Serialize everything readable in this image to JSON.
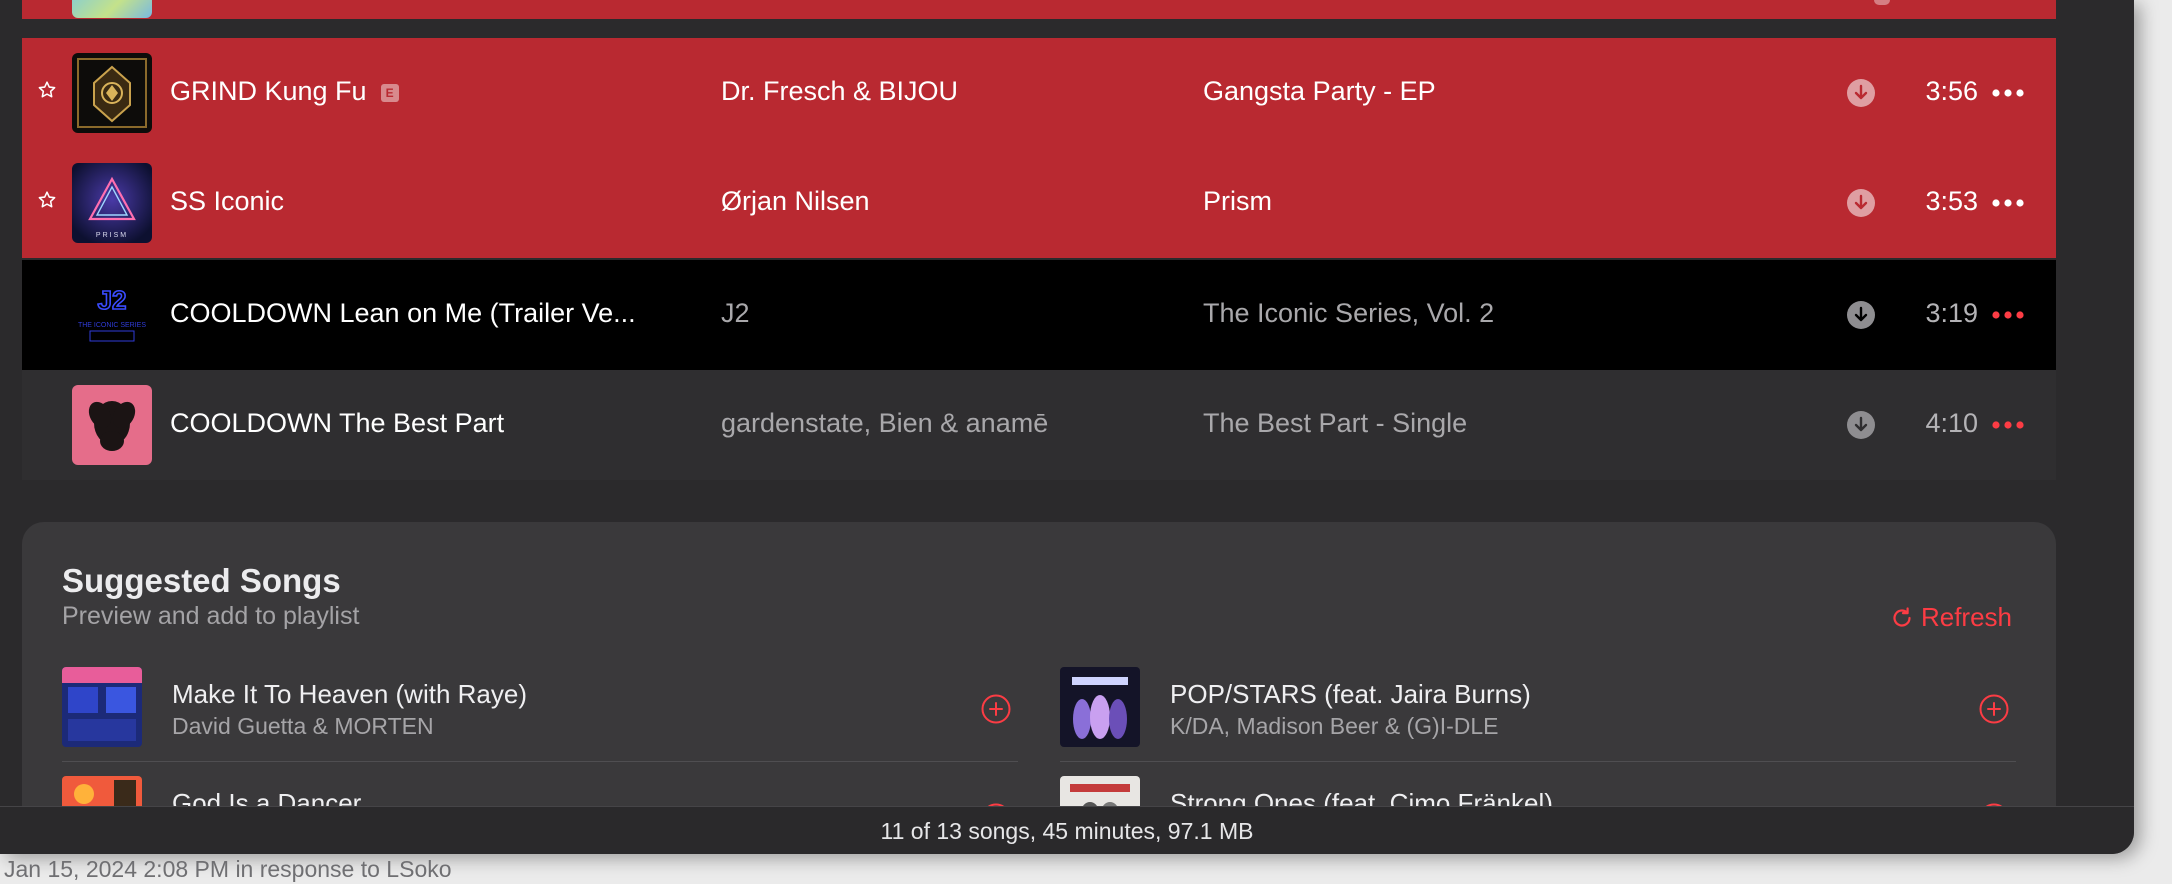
{
  "songs": [
    {
      "title": "GRIND Kung Fu",
      "explicit": "E",
      "artist": "Dr. Fresch & BIJOU",
      "album": "Gangsta Party - EP",
      "duration": "3:56",
      "starred": true
    },
    {
      "title": "SS Iconic",
      "artist": "Ørjan Nilsen",
      "album": "Prism",
      "duration": "3:53",
      "starred": true
    },
    {
      "title": "COOLDOWN Lean on Me (Trailer Ve...",
      "artist": "J2",
      "album": "The Iconic Series, Vol. 2",
      "duration": "3:19"
    },
    {
      "title": "COOLDOWN The Best Part",
      "artist": "gardenstate, Bien & anamē",
      "album": "The Best Part - Single",
      "duration": "4:10"
    }
  ],
  "art_text": {
    "prism": "PRISM",
    "j2": "J2",
    "j2_sub": "THE ICONIC SERIES"
  },
  "suggested": {
    "heading": "Suggested Songs",
    "subheading": "Preview and add to playlist",
    "refresh_label": "Refresh",
    "items": [
      {
        "title": "Make It To Heaven (with Raye)",
        "artist": "David Guetta & MORTEN"
      },
      {
        "title": "POP/STARS (feat. Jaira Burns)",
        "artist": "K/DA, Madison Beer & (G)I-DLE"
      },
      {
        "title": "God Is a Dancer",
        "artist": ""
      },
      {
        "title": "Strong Ones (feat. Cimo Fränkel)",
        "artist": ""
      }
    ]
  },
  "status": "11 of 13 songs, 45 minutes, 97.1 MB",
  "caption": "Jan 15, 2024 2:08 PM in response to LSoko",
  "colors": {
    "accent": "#fc3c44",
    "selected_row": "#b92931"
  },
  "icons": {
    "star": "star-icon",
    "download": "download-icon",
    "more": "more-icon",
    "add": "add-circle-icon",
    "refresh": "refresh-icon"
  }
}
